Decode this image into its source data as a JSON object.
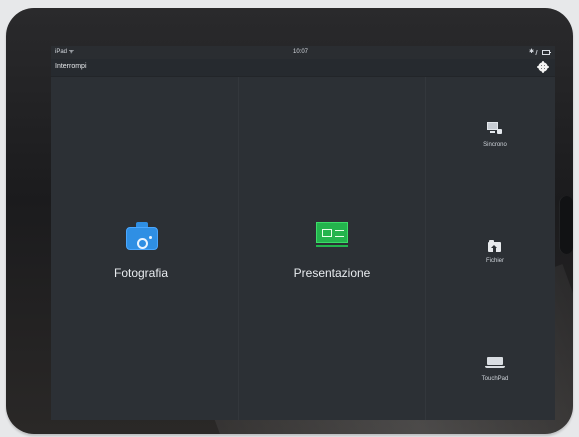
{
  "status_bar": {
    "left_text": "iPad ᯤ",
    "time": "10:07",
    "right_text": "✱"
  },
  "toolbar": {
    "stop_label": "Interrompi",
    "settings_icon": "gear-icon"
  },
  "main_actions": [
    {
      "label": "Fotografia",
      "icon": "camera-icon",
      "accent_color": "#2f8fe4"
    },
    {
      "label": "Presentazione",
      "icon": "presentation-icon",
      "accent_color": "#24b44d"
    }
  ],
  "side_tools": [
    {
      "label": "Sincrono",
      "icon": "monitor-sync-icon"
    },
    {
      "label": "Fichier",
      "icon": "folder-upload-icon"
    },
    {
      "label": "TouchPad",
      "icon": "laptop-icon"
    }
  ],
  "colors": {
    "screen_background": "#2c3035",
    "toolbar_background": "#262a2f",
    "text": "#e8ebef"
  }
}
